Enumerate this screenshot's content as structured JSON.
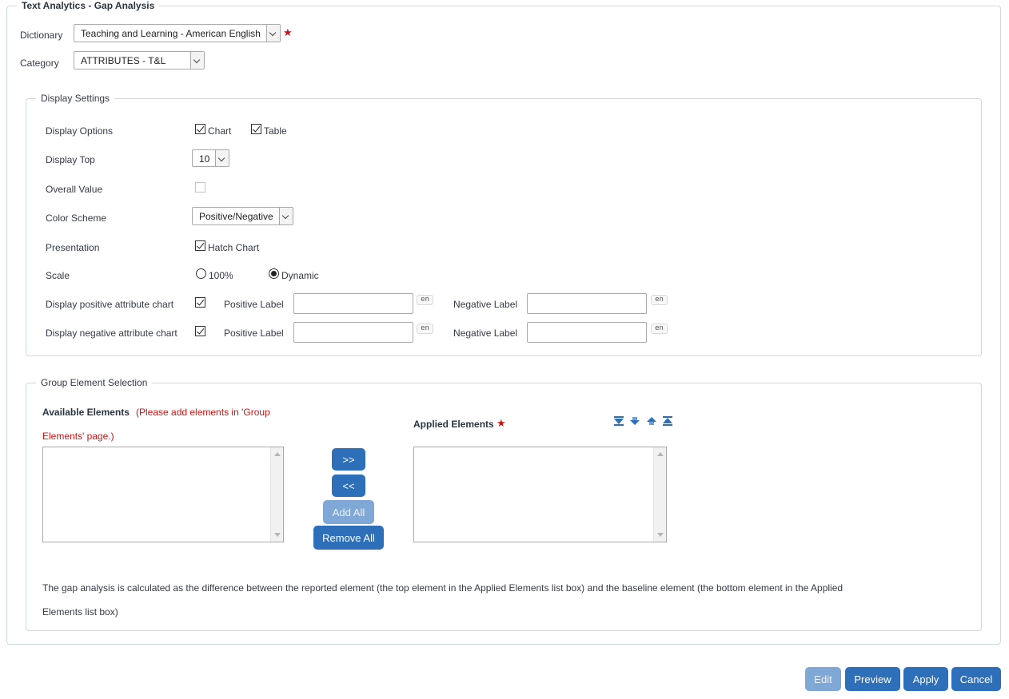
{
  "title": "Text Analytics - Gap Analysis",
  "dictionary": {
    "label": "Dictionary",
    "value": "Teaching and Learning - American English"
  },
  "category": {
    "label": "Category",
    "value": "ATTRIBUTES - T&L"
  },
  "display_settings": {
    "legend": "Display Settings",
    "display_options": {
      "label": "Display Options",
      "chart_label": "Chart",
      "chart_checked": true,
      "table_label": "Table",
      "table_checked": true
    },
    "display_top": {
      "label": "Display Top",
      "value": "10"
    },
    "overall_value": {
      "label": "Overall Value",
      "checked": false
    },
    "color_scheme": {
      "label": "Color Scheme",
      "value": "Positive/Negative"
    },
    "presentation": {
      "label": "Presentation",
      "hatch_label": "Hatch Chart",
      "hatch_checked": true
    },
    "scale": {
      "label": "Scale",
      "option1": "100%",
      "option2": "Dynamic",
      "selected": "Dynamic"
    },
    "positive_chart": {
      "label": "Display positive attribute chart",
      "checked": true,
      "positive_label": "Positive Label",
      "negative_label": "Negative Label",
      "positive_value": "",
      "negative_value": ""
    },
    "negative_chart": {
      "label": "Display negative attribute chart",
      "checked": true,
      "positive_label": "Positive Label",
      "negative_label": "Negative Label",
      "positive_value": "",
      "negative_value": ""
    },
    "lang_tag": "en"
  },
  "group_selection": {
    "legend": "Group Element Selection",
    "available_label": "Available Elements",
    "available_note_line1": "(Please add elements in 'Group",
    "available_note_line2": "Elements' page.)",
    "applied_label": "Applied Elements",
    "buttons": {
      "add": ">>",
      "remove": "<<",
      "add_all": "Add All",
      "remove_all": "Remove All"
    },
    "note_line1": "The gap analysis is calculated as the difference between the reported element (the top element in the Applied Elements list box) and the baseline element (the bottom element in the Applied",
    "note_line2": "Elements list box)"
  },
  "footer": {
    "edit": "Edit",
    "preview": "Preview",
    "apply": "Apply",
    "cancel": "Cancel"
  },
  "icons": [
    "move-bottom-icon",
    "move-down-icon",
    "move-up-icon",
    "move-top-icon",
    "required-star-icon"
  ],
  "colors": {
    "button": "#2d6fb8",
    "button_disabled": "#7fa8d6",
    "required": "#d31111"
  }
}
